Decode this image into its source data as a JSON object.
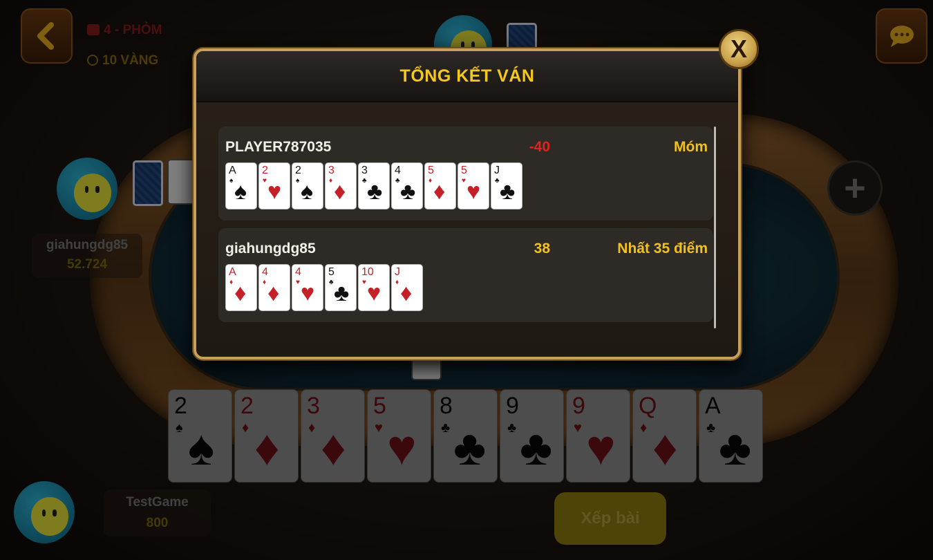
{
  "room": {
    "mode": "4 - PHỎM",
    "stake": "10 VÀNG"
  },
  "players": {
    "left": {
      "name": "giahungdg85",
      "money": "52.724"
    },
    "me": {
      "name": "TestGame",
      "money": "800"
    }
  },
  "buttons": {
    "sort_label": "Xếp bài",
    "close_label": "X",
    "add_player": "+"
  },
  "hand": [
    {
      "rank": "2",
      "suit": "♠",
      "color": "blk"
    },
    {
      "rank": "2",
      "suit": "♦",
      "color": "red"
    },
    {
      "rank": "3",
      "suit": "♦",
      "color": "red"
    },
    {
      "rank": "5",
      "suit": "♥",
      "color": "red"
    },
    {
      "rank": "8",
      "suit": "♣",
      "color": "blk"
    },
    {
      "rank": "9",
      "suit": "♣",
      "color": "blk"
    },
    {
      "rank": "9",
      "suit": "♥",
      "color": "red"
    },
    {
      "rank": "Q",
      "suit": "♦",
      "color": "red"
    },
    {
      "rank": "A",
      "suit": "♣",
      "color": "blk"
    }
  ],
  "summary": {
    "title": "TỔNG KẾT VÁN",
    "rows": [
      {
        "name": "PLAYER787035",
        "score": "-40",
        "score_color": "#e0241c",
        "result": "Móm",
        "cards": [
          {
            "rank": "A",
            "suit": "♠",
            "color": "blk"
          },
          {
            "rank": "2",
            "suit": "♥",
            "color": "red"
          },
          {
            "rank": "2",
            "suit": "♠",
            "color": "blk"
          },
          {
            "rank": "3",
            "suit": "♦",
            "color": "red"
          },
          {
            "rank": "3",
            "suit": "♣",
            "color": "blk"
          },
          {
            "rank": "4",
            "suit": "♣",
            "color": "blk"
          },
          {
            "rank": "5",
            "suit": "♦",
            "color": "red"
          },
          {
            "rank": "5",
            "suit": "♥",
            "color": "red"
          },
          {
            "rank": "J",
            "suit": "♣",
            "color": "blk"
          }
        ]
      },
      {
        "name": "giahungdg85",
        "score": "38",
        "score_color": "#f2c21c",
        "result": "Nhất 35 điểm",
        "cards": [
          {
            "rank": "A",
            "suit": "♦",
            "color": "red"
          },
          {
            "rank": "4",
            "suit": "♦",
            "color": "red"
          },
          {
            "rank": "4",
            "suit": "♥",
            "color": "red"
          },
          {
            "rank": "5",
            "suit": "♣",
            "color": "blk"
          },
          {
            "rank": "10",
            "suit": "♥",
            "color": "red"
          },
          {
            "rank": "J",
            "suit": "♦",
            "color": "red"
          }
        ]
      }
    ]
  },
  "colors": {
    "accent_gold": "#f4c81c",
    "modal_border": "#c9a05a",
    "loss_red": "#e0241c"
  }
}
